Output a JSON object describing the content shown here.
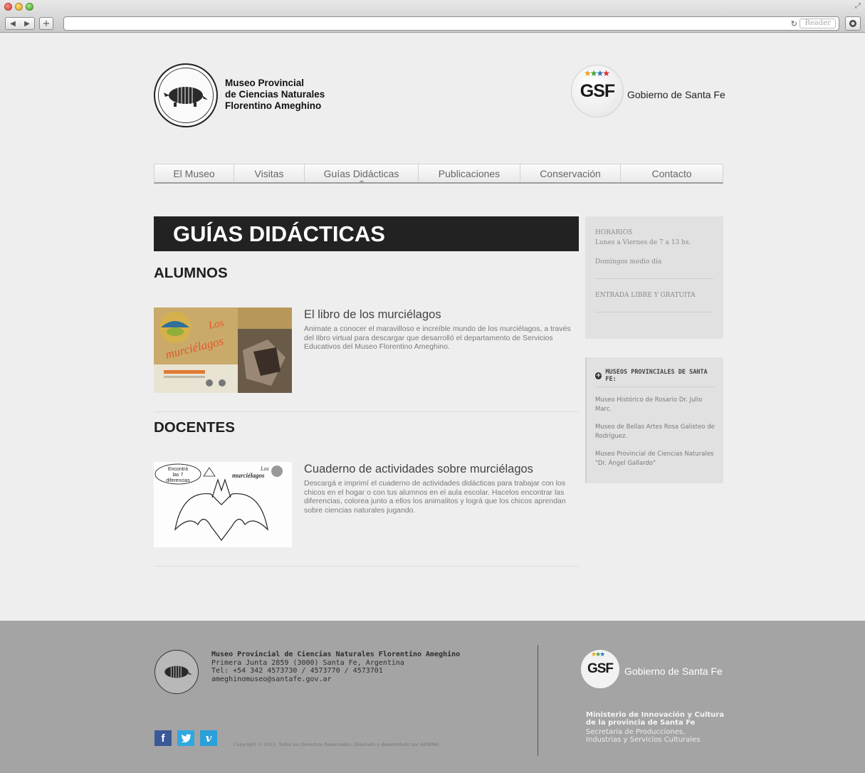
{
  "browser": {
    "reader_label": "Reader"
  },
  "header": {
    "museum_name": [
      "Museo Provincial",
      "de Ciencias Naturales",
      "Florentino Ameghino"
    ],
    "gsf_logo": "GSF",
    "gsf_text": "Gobierno de Santa Fe"
  },
  "nav": {
    "items": [
      {
        "label": "El Museo",
        "width": 0
      },
      {
        "label": "Visitas"
      },
      {
        "label": "Guías Didácticas",
        "active": true
      },
      {
        "label": "Publicaciones"
      },
      {
        "label": "Conservación"
      },
      {
        "label": "Contacto"
      }
    ]
  },
  "main": {
    "title": "GUÍAS DIDÁCTICAS",
    "sections": [
      {
        "heading": "ALUMNOS",
        "item_title": "El libro de los murciélagos",
        "item_desc": "Animate a conocer el maravilloso e increíble mundo de los murciélagos, a través del libro virtual para descargar que desarrolló el departamento de Servicios Educativos del Museo Florentino Ameghino.",
        "thumb_text": "Los murciélagos"
      },
      {
        "heading": "DOCENTES",
        "item_title": "Cuaderno de actividades sobre murciélagos",
        "item_desc": "Descargá e imprimí el cuaderno de actividades didácticas para trabajar con los chicos en el hogar o con tus alumnos en el aula escolar. Hacelos encontrar las diferencias, colorea junto a ellos los animalitos y lográ que los chicos aprendan sobre ciencias naturales jugando.",
        "thumb_text": "Los murciélagos",
        "thumb_bubble": "Encontrá las 7 diferencias"
      }
    ]
  },
  "sidebar": {
    "hours_title": "HORARIOS",
    "hours_line": "Lunes a Viernes de 7 a 13 hs.",
    "sunday": "Domingos medio día",
    "entry": "ENTRADA LIBRE Y GRATUITA",
    "museums_heading": "MUSEOS PROVINCIALES DE SANTA FE:",
    "museums": [
      "Museo Histórico de Rosario Dr. Julio Marc.",
      "Museo de Bellas Artes Rosa Galisteo de Rodríguez.",
      "Museo Provincial de Ciencias Naturales \"Dr. Ángel Gallardo\""
    ]
  },
  "footer": {
    "name": "Museo Provincial de Ciencias Naturales Florentino Ameghino",
    "address": "Primera Junta 2859 (3000) Santa Fe, Argentina",
    "phone": "Tel: +54 342 4573730 / 4573770 / 4573701",
    "email": "ameghinomuseo@santafe.gov.ar",
    "copyright": "Copyright © 2013. Todos los Derechos Reservados. Diseñado y desarrollado por AENIMA.",
    "gsf_logo": "GSF",
    "gsf_text": "Gobierno de Santa Fe",
    "ministry": [
      "Ministerio de Innovación y Cultura",
      "de la provincia de Santa Fe"
    ],
    "secretaria": [
      "Secretaría de Producciones,",
      "Industrias y Servicios Culturales"
    ],
    "social": [
      "f",
      "t",
      "v"
    ]
  }
}
